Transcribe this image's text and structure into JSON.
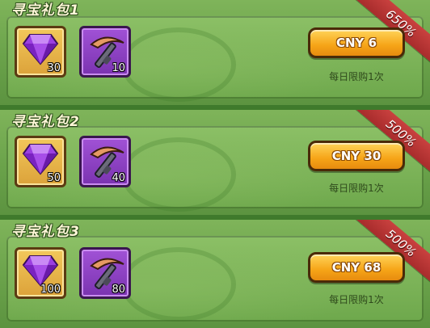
{
  "packs": [
    {
      "title": "寻宝礼包1",
      "discount": "650%",
      "gem_qty": "30",
      "pickaxe_qty": "10",
      "price": "CNY 6",
      "limit": "每日限购1次"
    },
    {
      "title": "寻宝礼包2",
      "discount": "500%",
      "gem_qty": "50",
      "pickaxe_qty": "40",
      "price": "CNY 30",
      "limit": "每日限购1次"
    },
    {
      "title": "寻宝礼包3",
      "discount": "500%",
      "gem_qty": "100",
      "pickaxe_qty": "80",
      "price": "CNY 68",
      "limit": "每日限购1次"
    }
  ],
  "icons": {
    "gem": "purple-gem-icon",
    "pickaxe": "pickaxe-icon"
  },
  "colors": {
    "ribbon": "#b8343a",
    "button": "#f6a417",
    "gem_slot": "#dca23a",
    "pickaxe_slot": "#7a33b0"
  }
}
